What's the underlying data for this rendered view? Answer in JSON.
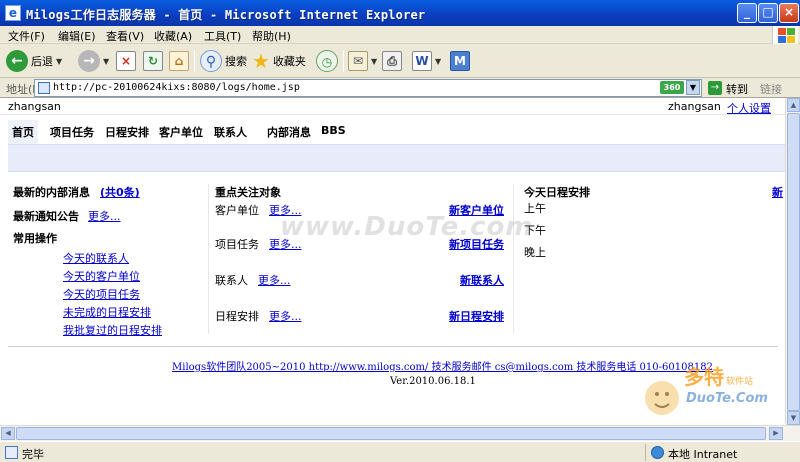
{
  "window": {
    "title": "Milogs工作日志服务器 - 首页 - Microsoft Internet Explorer",
    "buttons": {
      "minimize": "_",
      "maximize": "□",
      "close": "×"
    }
  },
  "menu": [
    "文件(F)",
    "编辑(E)",
    "查看(V)",
    "收藏(A)",
    "工具(T)",
    "帮助(H)"
  ],
  "toolbar": {
    "back_label": "后退",
    "search_label": "搜索",
    "favorites_label": "收藏夹"
  },
  "address": {
    "label": "地址(D)",
    "url": "http://pc-20100624kixs:8080/logs/home.jsp",
    "badge": "360",
    "go_label": "转到",
    "links_label": "链接"
  },
  "page": {
    "username": "zhangsan",
    "username_right": "zhangsan",
    "settings": "个人设置",
    "nav": [
      "首页",
      "项目任务",
      "日程安排",
      "客户单位",
      "联系人",
      "内部消息",
      "BBS"
    ],
    "left": {
      "internal_msg_title": "最新的内部消息",
      "internal_msg_count": "(共0条)",
      "notice_title": "最新通知公告",
      "notice_more": "更多...",
      "common_ops_title": "常用操作",
      "ops": [
        "今天的联系人",
        "今天的客户单位",
        "今天的项目任务",
        "未完成的日程安排",
        "我批复过的日程安排"
      ]
    },
    "middle": {
      "title": "重点关注对象",
      "rows": [
        {
          "label": "客户单位",
          "more": "更多...",
          "action": "新客户单位"
        },
        {
          "label": "项目任务",
          "more": "更多...",
          "action": "新项目任务"
        },
        {
          "label": "联系人",
          "more": "更多...",
          "action": "新联系人"
        },
        {
          "label": "日程安排",
          "more": "更多...",
          "action": "新日程安排"
        }
      ]
    },
    "right": {
      "title": "今天日程安排",
      "new_link": "新",
      "periods": [
        "上午",
        "下午",
        "晚上"
      ]
    },
    "footer": {
      "line": "Milogs软件团队2005~2010  http://www.milogs.com/  技术服务邮件 cs@milogs.com  技术服务电话 010-60108182",
      "version": "Ver.2010.06.18.1"
    },
    "watermark": "www.DuoTe.com",
    "watermark_logo": "多特软件站 DuoTe.Com"
  },
  "status": {
    "text": "完毕",
    "zone": "本地 Intranet"
  }
}
